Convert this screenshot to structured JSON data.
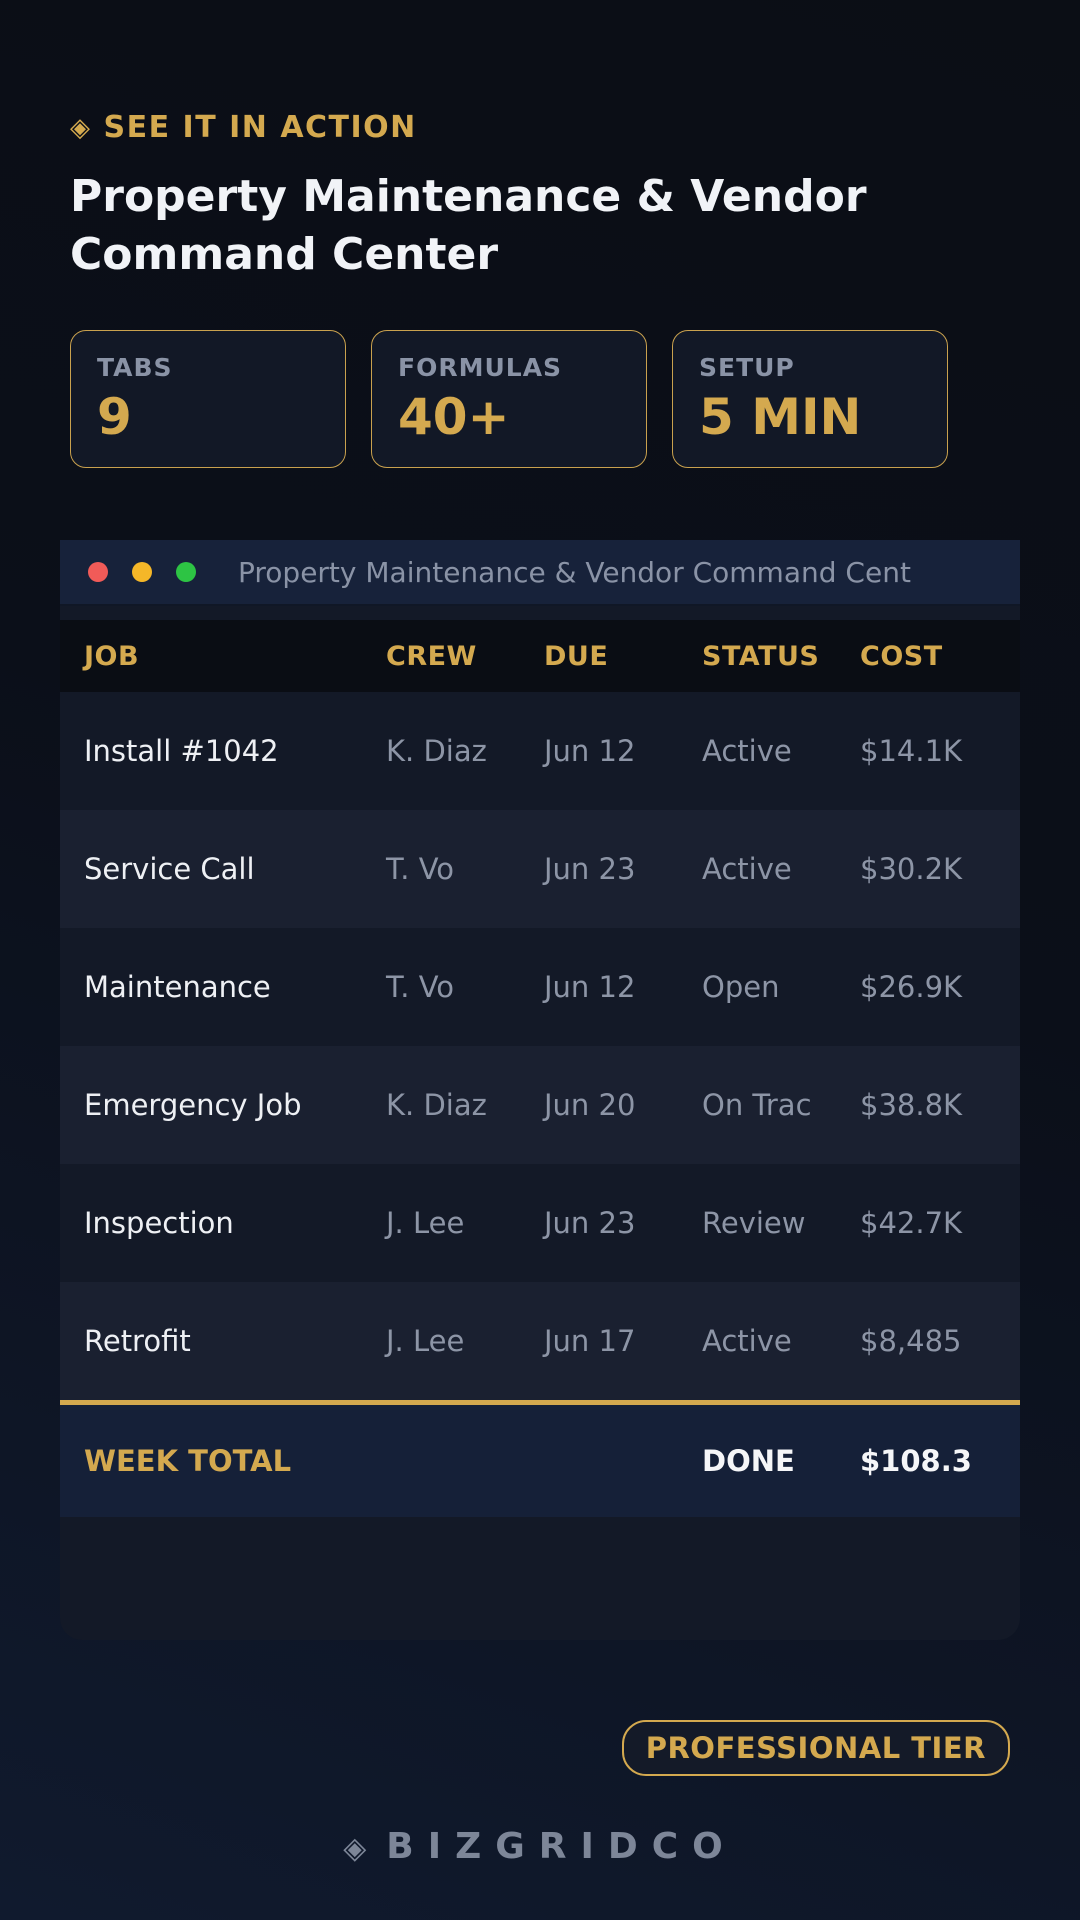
{
  "header": {
    "eyebrow": "SEE IT IN ACTION",
    "eyebrow_icon": "diamond-icon",
    "title": "Property Maintenance & Vendor Command Center"
  },
  "stats": [
    {
      "label": "TABS",
      "value": "9"
    },
    {
      "label": "FORMULAS",
      "value": "40+"
    },
    {
      "label": "SETUP",
      "value": "5 MIN"
    }
  ],
  "window": {
    "title": "Property Maintenance & Vendor Command Cent"
  },
  "table": {
    "columns": [
      "JOB",
      "CREW",
      "DUE",
      "STATUS",
      "COST"
    ],
    "rows": [
      {
        "job": "Install #1042",
        "crew": "K. Diaz",
        "due": "Jun 12",
        "status": "Active",
        "cost": "$14.1K"
      },
      {
        "job": "Service Call",
        "crew": "T. Vo",
        "due": "Jun 23",
        "status": "Active",
        "cost": "$30.2K"
      },
      {
        "job": "Maintenance",
        "crew": "T. Vo",
        "due": "Jun 12",
        "status": "Open",
        "cost": "$26.9K"
      },
      {
        "job": "Emergency Job",
        "crew": "K. Diaz",
        "due": "Jun 20",
        "status": "On Trac",
        "cost": "$38.8K"
      },
      {
        "job": "Inspection",
        "crew": "J. Lee",
        "due": "Jun 23",
        "status": "Review",
        "cost": "$42.7K"
      },
      {
        "job": "Retrofit",
        "crew": "J. Lee",
        "due": "Jun 17",
        "status": "Active",
        "cost": "$8,485"
      }
    ],
    "total": {
      "label": "WEEK TOTAL",
      "status": "DONE",
      "cost": "$108.3"
    }
  },
  "badge": {
    "label": "PROFESSIONAL TIER"
  },
  "brand": {
    "name": "BIZGRIDCO",
    "icon": "diamond-icon"
  },
  "colors": {
    "accent": "#d4a94f",
    "background": "#0b0f19",
    "text": "#f1f3f7",
    "muted": "#8a93a6"
  }
}
